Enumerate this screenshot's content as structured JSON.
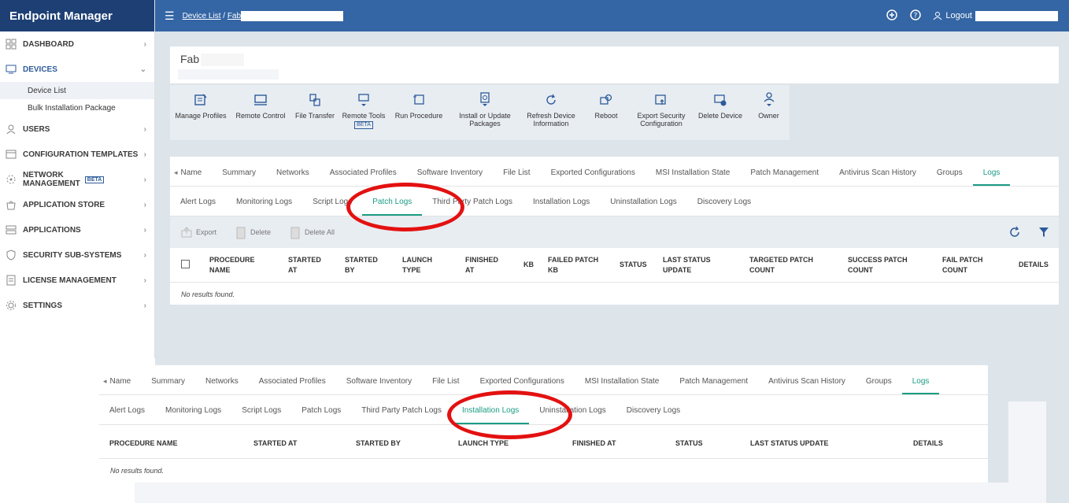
{
  "brand": "Endpoint Manager",
  "breadcrumb": {
    "device_list": "Device List",
    "sep": "/",
    "current": "Fab"
  },
  "topbar": {
    "logout": "Logout"
  },
  "sidebar": {
    "items": [
      {
        "label": "DASHBOARD"
      },
      {
        "label": "DEVICES"
      },
      {
        "label": "USERS"
      },
      {
        "label": "CONFIGURATION TEMPLATES"
      },
      {
        "label": "NETWORK MANAGEMENT",
        "badge": "BETA"
      },
      {
        "label": "APPLICATION STORE"
      },
      {
        "label": "APPLICATIONS"
      },
      {
        "label": "SECURITY SUB-SYSTEMS"
      },
      {
        "label": "LICENSE MANAGEMENT"
      },
      {
        "label": "SETTINGS"
      }
    ],
    "subitems": [
      "Device List",
      "Bulk Installation Package"
    ]
  },
  "device": {
    "name": "Fab"
  },
  "toolbar": [
    {
      "label": "Manage Profiles",
      "icon": "manage-profiles-icon"
    },
    {
      "label": "Remote Control",
      "icon": "monitor-icon"
    },
    {
      "label": "File Transfer",
      "icon": "file-transfer-icon"
    },
    {
      "label": "Remote Tools",
      "icon": "remote-tools-icon",
      "badge": "BETA"
    },
    {
      "label": "Run Procedure",
      "icon": "run-procedure-icon"
    },
    {
      "label": "Install or Update Packages",
      "icon": "package-icon"
    },
    {
      "label": "Refresh Device Information",
      "icon": "refresh-icon"
    },
    {
      "label": "Reboot",
      "icon": "reboot-icon"
    },
    {
      "label": "Export Security Configuration",
      "icon": "export-config-icon"
    },
    {
      "label": "Delete Device",
      "icon": "delete-device-icon"
    },
    {
      "label": "Owner",
      "icon": "owner-icon"
    }
  ],
  "tabs": [
    "Name",
    "Summary",
    "Networks",
    "Associated Profiles",
    "Software Inventory",
    "File List",
    "Exported Configurations",
    "MSI Installation State",
    "Patch Management",
    "Antivirus Scan History",
    "Groups",
    "Logs"
  ],
  "subtabs": [
    "Alert Logs",
    "Monitoring Logs",
    "Script Logs",
    "Patch Logs",
    "Third Party Patch Logs",
    "Installation Logs",
    "Uninstallation Logs",
    "Discovery Logs"
  ],
  "actions": {
    "export": "Export",
    "delete": "Delete",
    "delete_all": "Delete All"
  },
  "patch_columns": [
    "PROCEDURE NAME",
    "STARTED AT",
    "STARTED BY",
    "LAUNCH TYPE",
    "FINISHED AT",
    "KB",
    "FAILED PATCH KB",
    "STATUS",
    "LAST STATUS UPDATE",
    "TARGETED PATCH COUNT",
    "SUCCESS PATCH COUNT",
    "FAIL PATCH COUNT",
    "DETAILS"
  ],
  "install_columns": [
    "PROCEDURE NAME",
    "STARTED AT",
    "STARTED BY",
    "LAUNCH TYPE",
    "FINISHED AT",
    "STATUS",
    "LAST STATUS UPDATE",
    "DETAILS"
  ],
  "no_results": "No results found.",
  "colors": {
    "nav": "#1d3f74",
    "topbar": "#3465a4",
    "accent": "#1a9c84",
    "highlight": "#e31111"
  }
}
